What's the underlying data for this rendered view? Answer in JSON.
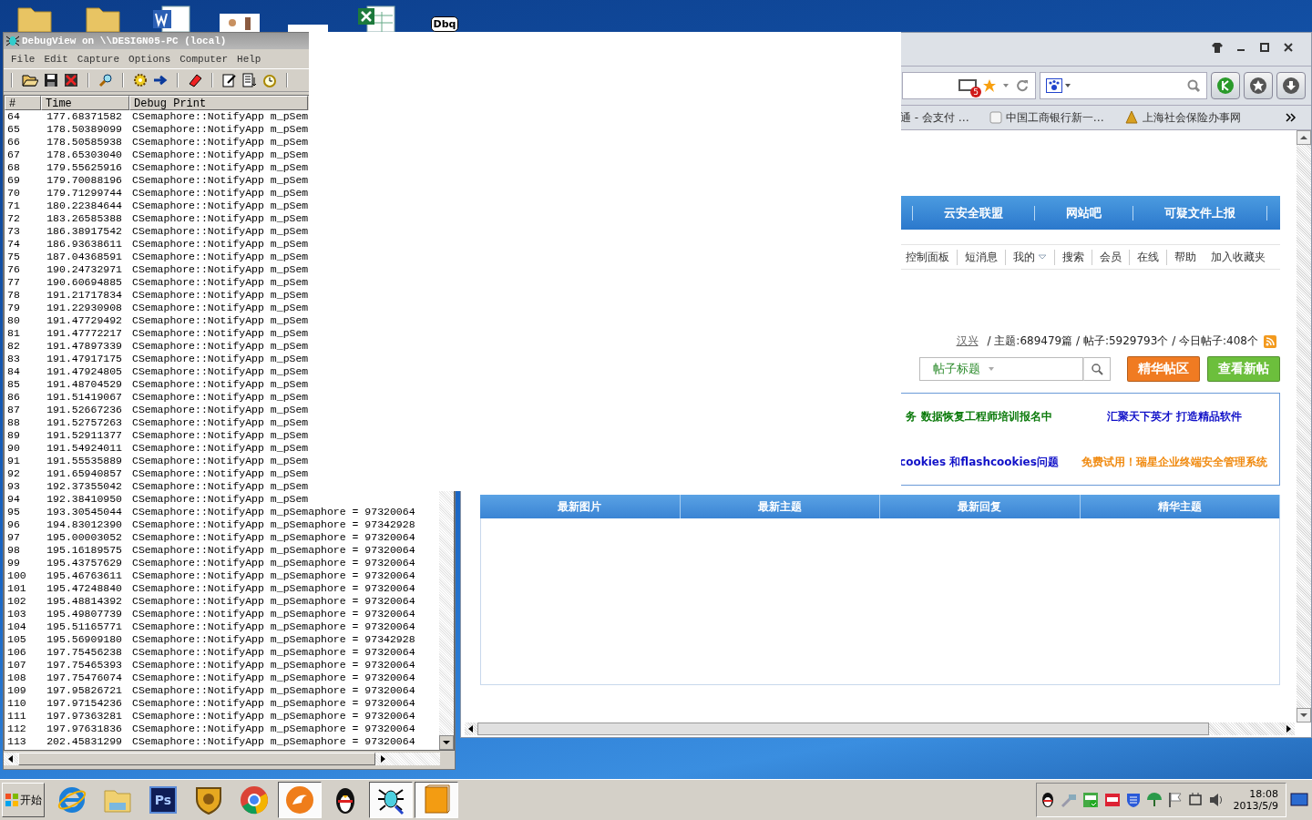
{
  "desktop_icons": [
    {
      "kind": "folder"
    },
    {
      "kind": "folder"
    },
    {
      "kind": "document"
    },
    {
      "kind": "picture"
    },
    {
      "kind": "blank"
    },
    {
      "kind": "spreadsheet"
    },
    {
      "kind": "app",
      "label": "Dbq"
    }
  ],
  "debugview": {
    "title": "DebugView on \\\\DESIGN05-PC (local)",
    "menu": [
      "File",
      "Edit",
      "Capture",
      "Options",
      "Computer",
      "Help"
    ],
    "columns": [
      "#",
      "Time",
      "Debug Print"
    ],
    "rows": [
      {
        "n": "64",
        "time": "177.68371582",
        "text": "CSemaphore::NotifyApp m_pSem"
      },
      {
        "n": "65",
        "time": "178.50389099",
        "text": "CSemaphore::NotifyApp m_pSem"
      },
      {
        "n": "66",
        "time": "178.50585938",
        "text": "CSemaphore::NotifyApp m_pSem"
      },
      {
        "n": "67",
        "time": "178.65303040",
        "text": "CSemaphore::NotifyApp m_pSem"
      },
      {
        "n": "68",
        "time": "179.55625916",
        "text": "CSemaphore::NotifyApp m_pSem"
      },
      {
        "n": "69",
        "time": "179.70088196",
        "text": "CSemaphore::NotifyApp m_pSem"
      },
      {
        "n": "70",
        "time": "179.71299744",
        "text": "CSemaphore::NotifyApp m_pSem"
      },
      {
        "n": "71",
        "time": "180.22384644",
        "text": "CSemaphore::NotifyApp m_pSem"
      },
      {
        "n": "72",
        "time": "183.26585388",
        "text": "CSemaphore::NotifyApp m_pSem"
      },
      {
        "n": "73",
        "time": "186.38917542",
        "text": "CSemaphore::NotifyApp m_pSem"
      },
      {
        "n": "74",
        "time": "186.93638611",
        "text": "CSemaphore::NotifyApp m_pSem"
      },
      {
        "n": "75",
        "time": "187.04368591",
        "text": "CSemaphore::NotifyApp m_pSem"
      },
      {
        "n": "76",
        "time": "190.24732971",
        "text": "CSemaphore::NotifyApp m_pSem"
      },
      {
        "n": "77",
        "time": "190.60694885",
        "text": "CSemaphore::NotifyApp m_pSem"
      },
      {
        "n": "78",
        "time": "191.21717834",
        "text": "CSemaphore::NotifyApp m_pSem"
      },
      {
        "n": "79",
        "time": "191.22930908",
        "text": "CSemaphore::NotifyApp m_pSem"
      },
      {
        "n": "80",
        "time": "191.47729492",
        "text": "CSemaphore::NotifyApp m_pSem"
      },
      {
        "n": "81",
        "time": "191.47772217",
        "text": "CSemaphore::NotifyApp m_pSem"
      },
      {
        "n": "82",
        "time": "191.47897339",
        "text": "CSemaphore::NotifyApp m_pSem"
      },
      {
        "n": "83",
        "time": "191.47917175",
        "text": "CSemaphore::NotifyApp m_pSem"
      },
      {
        "n": "84",
        "time": "191.47924805",
        "text": "CSemaphore::NotifyApp m_pSem"
      },
      {
        "n": "85",
        "time": "191.48704529",
        "text": "CSemaphore::NotifyApp m_pSem"
      },
      {
        "n": "86",
        "time": "191.51419067",
        "text": "CSemaphore::NotifyApp m_pSem"
      },
      {
        "n": "87",
        "time": "191.52667236",
        "text": "CSemaphore::NotifyApp m_pSem"
      },
      {
        "n": "88",
        "time": "191.52757263",
        "text": "CSemaphore::NotifyApp m_pSem"
      },
      {
        "n": "89",
        "time": "191.52911377",
        "text": "CSemaphore::NotifyApp m_pSem"
      },
      {
        "n": "90",
        "time": "191.54924011",
        "text": "CSemaphore::NotifyApp m_pSem"
      },
      {
        "n": "91",
        "time": "191.55535889",
        "text": "CSemaphore::NotifyApp m_pSem"
      },
      {
        "n": "92",
        "time": "191.65940857",
        "text": "CSemaphore::NotifyApp m_pSem"
      },
      {
        "n": "93",
        "time": "192.37355042",
        "text": "CSemaphore::NotifyApp m_pSem"
      },
      {
        "n": "94",
        "time": "192.38410950",
        "text": "CSemaphore::NotifyApp m_pSem"
      },
      {
        "n": "95",
        "time": "193.30545044",
        "text": "CSemaphore::NotifyApp m_pSemaphore = 97320064"
      },
      {
        "n": "96",
        "time": "194.83012390",
        "text": "CSemaphore::NotifyApp m_pSemaphore = 97342928"
      },
      {
        "n": "97",
        "time": "195.00003052",
        "text": "CSemaphore::NotifyApp m_pSemaphore = 97320064"
      },
      {
        "n": "98",
        "time": "195.16189575",
        "text": "CSemaphore::NotifyApp m_pSemaphore = 97320064"
      },
      {
        "n": "99",
        "time": "195.43757629",
        "text": "CSemaphore::NotifyApp m_pSemaphore = 97320064"
      },
      {
        "n": "100",
        "time": "195.46763611",
        "text": "CSemaphore::NotifyApp m_pSemaphore = 97320064"
      },
      {
        "n": "101",
        "time": "195.47248840",
        "text": "CSemaphore::NotifyApp m_pSemaphore = 97320064"
      },
      {
        "n": "102",
        "time": "195.48814392",
        "text": "CSemaphore::NotifyApp m_pSemaphore = 97320064"
      },
      {
        "n": "103",
        "time": "195.49807739",
        "text": "CSemaphore::NotifyApp m_pSemaphore = 97320064"
      },
      {
        "n": "104",
        "time": "195.51165771",
        "text": "CSemaphore::NotifyApp m_pSemaphore = 97320064"
      },
      {
        "n": "105",
        "time": "195.56909180",
        "text": "CSemaphore::NotifyApp m_pSemaphore = 97342928"
      },
      {
        "n": "106",
        "time": "197.75456238",
        "text": "CSemaphore::NotifyApp m_pSemaphore = 97320064"
      },
      {
        "n": "107",
        "time": "197.75465393",
        "text": "CSemaphore::NotifyApp m_pSemaphore = 97320064"
      },
      {
        "n": "108",
        "time": "197.75476074",
        "text": "CSemaphore::NotifyApp m_pSemaphore = 97320064"
      },
      {
        "n": "109",
        "time": "197.95826721",
        "text": "CSemaphore::NotifyApp m_pSemaphore = 97320064"
      },
      {
        "n": "110",
        "time": "197.97154236",
        "text": "CSemaphore::NotifyApp m_pSemaphore = 97320064"
      },
      {
        "n": "111",
        "time": "197.97363281",
        "text": "CSemaphore::NotifyApp m_pSemaphore = 97320064"
      },
      {
        "n": "112",
        "time": "197.97631836",
        "text": "CSemaphore::NotifyApp m_pSemaphore = 97320064"
      },
      {
        "n": "113",
        "time": "202.45831299",
        "text": "CSemaphore::NotifyApp m_pSemaphore = 97320064"
      }
    ]
  },
  "browser": {
    "tab_count": "5",
    "bookmarks": [
      {
        "label": "通 - 会支付 …",
        "kind": "plain"
      },
      {
        "label": "中国工商银行新一…",
        "kind": "page"
      },
      {
        "label": "上海社会保险办事网",
        "kind": "badge"
      }
    ],
    "nav": [
      "云安全联盟",
      "网站吧",
      "可疑文件上报"
    ],
    "subnav": [
      {
        "label": "控制面板",
        "dropdown": false
      },
      {
        "label": "短消息",
        "dropdown": false
      },
      {
        "label": "我的",
        "dropdown": true
      },
      {
        "label": "搜索",
        "dropdown": false
      },
      {
        "label": "会员",
        "dropdown": false
      },
      {
        "label": "在线",
        "dropdown": false
      },
      {
        "label": "帮助",
        "dropdown": false
      },
      {
        "label": "加入收藏夹",
        "dropdown": false
      }
    ],
    "stats": {
      "user": "汉兴",
      "text": "/ 主题:689479篇 / 帖子:5929793个 / 今日帖子:408个"
    },
    "search": {
      "scope": "帖子标题"
    },
    "buttons": [
      {
        "label": "精华帖区",
        "color": "#f07b22"
      },
      {
        "label": "查看新帖",
        "color": "#6cbf3c"
      }
    ],
    "links": [
      [
        {
          "text": "务 数据恢复工程师培训报名中",
          "color": "#0b7a0b"
        },
        {
          "text": "cookies 和flashcookies问题",
          "color": "#1010c8"
        }
      ],
      [
        {
          "text": "汇聚天下英才 打造精品软件",
          "color": "#1010c8"
        },
        {
          "text": "免费试用！瑞星企业终端安全管理系统",
          "color": "#f08a10"
        }
      ]
    ],
    "tabs": [
      "最新图片",
      "最新主题",
      "最新回复",
      "精华主题"
    ]
  },
  "taskbar": {
    "start": "开始",
    "apps": [
      {
        "kind": "ie",
        "selected": false
      },
      {
        "kind": "folder",
        "selected": false
      },
      {
        "kind": "ps",
        "label": "Ps",
        "selected": false
      },
      {
        "kind": "shield",
        "selected": false
      },
      {
        "kind": "chrome",
        "selected": false
      },
      {
        "kind": "cheetah",
        "selected": true
      },
      {
        "kind": "penguin",
        "selected": false
      },
      {
        "kind": "bug",
        "selected": true
      },
      {
        "kind": "book",
        "selected": true
      }
    ],
    "time": "18:08",
    "date": "2013/5/9"
  }
}
